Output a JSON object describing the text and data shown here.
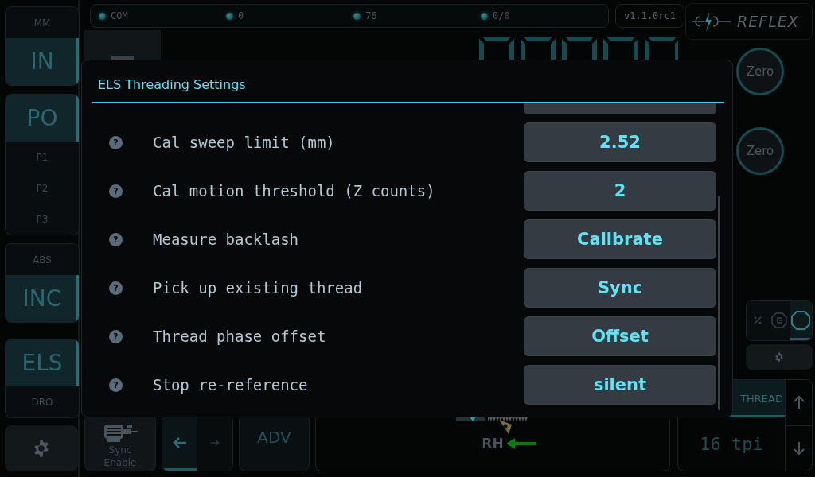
{
  "sidebar": {
    "groups": [
      {
        "options": [
          {
            "label": "MM",
            "kind": "small",
            "selected": false
          },
          {
            "label": "IN",
            "kind": "large",
            "selected": true
          }
        ]
      },
      {
        "options": [
          {
            "label": "PO",
            "kind": "large",
            "selected": true
          },
          {
            "label": "P1",
            "kind": "small",
            "selected": false
          },
          {
            "label": "P2",
            "kind": "small",
            "selected": false
          },
          {
            "label": "P3",
            "kind": "small",
            "selected": false
          }
        ]
      },
      {
        "options": [
          {
            "label": "ABS",
            "kind": "small",
            "selected": false
          },
          {
            "label": "INC",
            "kind": "large",
            "selected": true
          }
        ]
      },
      {
        "options": [
          {
            "label": "ELS",
            "kind": "large",
            "selected": true
          },
          {
            "label": "DRO",
            "kind": "small",
            "selected": false
          }
        ]
      }
    ]
  },
  "status_bar": {
    "indicators": [
      {
        "label": "COM"
      },
      {
        "label": "0"
      },
      {
        "label": "76"
      },
      {
        "label": "0/0"
      }
    ],
    "version": "v1.1.0rc1",
    "logo": "REFLEX"
  },
  "zero_buttons": [
    "Zero",
    "Zero"
  ],
  "mode_toggles": [
    {
      "kind": "percent",
      "selected": false
    },
    {
      "kind": "octagon-c",
      "selected": false
    },
    {
      "kind": "octagon",
      "selected": true
    }
  ],
  "bottom_bar": {
    "sync_button": "Sync Enable",
    "direction": [
      {
        "kind": "left",
        "selected": true
      },
      {
        "kind": "right",
        "selected": false
      }
    ],
    "adv_button": "ADV",
    "hand": "RH"
  },
  "thread": {
    "tab": "THREAD",
    "value": "16 tpi"
  },
  "dialog": {
    "title": "ELS Threading Settings",
    "rows": [
      {
        "help": "?",
        "label": "Cal sweep limit (mm)",
        "value": "2.52"
      },
      {
        "help": "?",
        "label": "Cal motion threshold (Z counts)",
        "value": "2"
      },
      {
        "help": "?",
        "label": "Measure backlash",
        "value": "Calibrate"
      },
      {
        "help": "?",
        "label": "Pick up existing thread",
        "value": "Sync"
      },
      {
        "help": "?",
        "label": "Thread phase offset",
        "value": "Offset"
      },
      {
        "help": "?",
        "label": "Stop re-reference",
        "value": "silent"
      }
    ]
  }
}
